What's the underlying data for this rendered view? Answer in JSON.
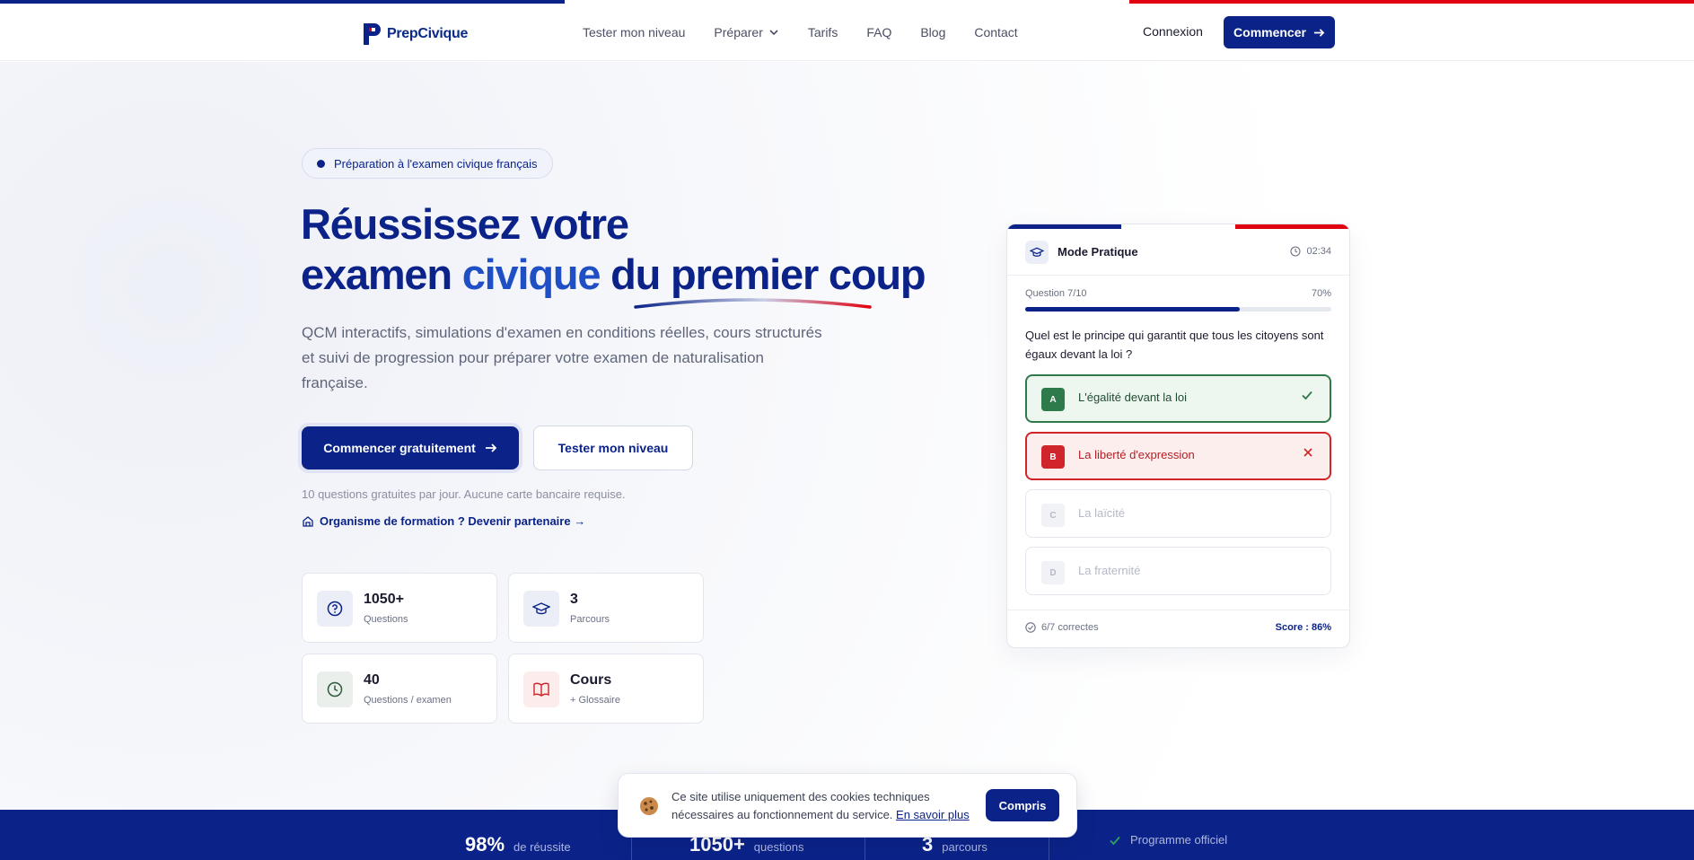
{
  "brand": {
    "name": "PrepCivique",
    "colors": {
      "blue": "#0b2389",
      "accent_blue": "#1f4fc4",
      "red": "#e1000f",
      "white": "#ffffff"
    }
  },
  "nav": {
    "items": [
      {
        "label": "Tester mon niveau"
      },
      {
        "label": "Préparer",
        "icon": "chevron-down-icon"
      },
      {
        "label": "Tarifs"
      },
      {
        "label": "FAQ"
      },
      {
        "label": "Blog"
      },
      {
        "label": "Contact"
      }
    ],
    "login": "Connexion",
    "cta": "Commencer"
  },
  "hero": {
    "badge": "Préparation à l'examen civique français",
    "title_line1": "Réussissez votre",
    "title_line2_a": "examen ",
    "title_line2_accent": "civique",
    "title_line2_b": " du ",
    "title_line2_c": "premier coup",
    "description": "QCM interactifs, simulations d'examen en conditions réelles, cours structurés et suivi de progression pour préparer votre examen de naturalisation française.",
    "primary_button": "Commencer gratuitement",
    "secondary_button": "Tester mon niveau",
    "note": "10 questions gratuites par jour. Aucune carte bancaire requise.",
    "partner_link": "Organisme de formation ? Devenir partenaire →"
  },
  "stats": [
    {
      "value": "1050+",
      "label": "Questions",
      "icon": "question-circle-icon"
    },
    {
      "value": "3",
      "label": "Parcours",
      "icon": "graduation-cap-icon"
    },
    {
      "value": "40",
      "label": "Questions / examen",
      "icon": "clock-icon"
    },
    {
      "value": "Cours",
      "label": "+ Glossaire",
      "icon": "book-open-icon"
    }
  ],
  "quiz": {
    "mode": "Mode Pratique",
    "timer": "02:34",
    "progress_label": "Question 7/10",
    "progress_pct_label": "70%",
    "progress": 0.7,
    "question": "Quel est le principe qui garantit que tous les citoyens sont égaux devant la loi ?",
    "options": [
      {
        "letter": "A",
        "text": "L'égalité devant la loi",
        "state": "correct"
      },
      {
        "letter": "B",
        "text": "La liberté d'expression",
        "state": "wrong"
      },
      {
        "letter": "C",
        "text": "La laïcité",
        "state": "neutral"
      },
      {
        "letter": "D",
        "text": "La fraternité",
        "state": "neutral"
      }
    ],
    "footer_left": "6/7 correctes",
    "footer_right": "Score : 86%"
  },
  "band": [
    {
      "num": "98%",
      "label": "de réussite"
    },
    {
      "num": "1050+",
      "label": "questions"
    },
    {
      "num": "3",
      "label": "parcours"
    },
    {
      "num": "",
      "label": "Programme officiel"
    }
  ],
  "cookie": {
    "text": "Ce site utilise uniquement des cookies techniques nécessaires au fonctionnement du service.",
    "link": "En savoir plus",
    "button": "Compris"
  }
}
